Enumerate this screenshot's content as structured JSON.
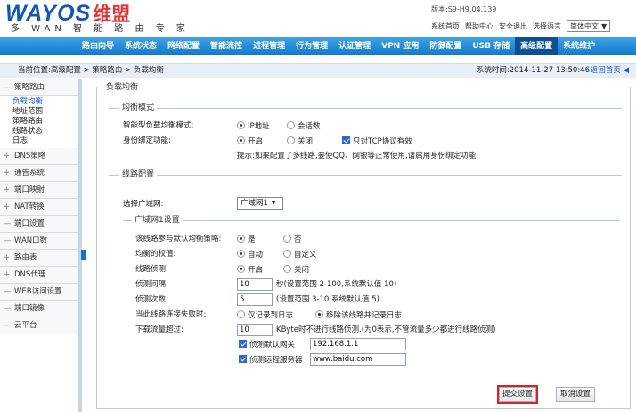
{
  "header": {
    "logo_text": "WAYOS",
    "logo_cn": "维盟",
    "logo_sub": "多 WAN 智 能 路 由 专 家",
    "version": "版本:S9-H9.04.139",
    "links": [
      "系统首页",
      "帮助中心",
      "安全退出",
      "选择语言"
    ],
    "language": "简体中文"
  },
  "nav": {
    "items": [
      "路由向导",
      "系统状态",
      "网络配置",
      "智能流控",
      "进程管理",
      "行为管理",
      "认证管理",
      "VPN 应用",
      "防御配置",
      "USB 存储",
      "高级配置",
      "系统维护"
    ],
    "active_index": 10
  },
  "breadcrumb": {
    "text": "当前位置:高级配置 > 策略路由 > 负载均衡",
    "time": "系统时间:2014-11-27 13:50:46",
    "home": "返回首页"
  },
  "sidebar": {
    "groups": [
      {
        "label": "策略路由",
        "sign": "—",
        "items": [
          "负载均衡",
          "地址范围",
          "策略路由",
          "线路状态",
          "日志"
        ]
      },
      {
        "label": "DNS策略",
        "sign": "+"
      },
      {
        "label": "通告系统",
        "sign": "+"
      },
      {
        "label": "端口映射",
        "sign": "+"
      },
      {
        "label": "NAT转换",
        "sign": "+"
      },
      {
        "label": "端口设置",
        "sign": "—"
      },
      {
        "label": "WAN口数",
        "sign": "—"
      },
      {
        "label": "路由表",
        "sign": "+"
      },
      {
        "label": "DNS代理",
        "sign": "+"
      },
      {
        "label": "WEB访问设置",
        "sign": "—"
      },
      {
        "label": "端口镜像",
        "sign": "—"
      },
      {
        "label": "云平台",
        "sign": "—"
      }
    ]
  },
  "form": {
    "panel_title": "负载均衡",
    "balance": {
      "title": "均衡模式",
      "mode_label": "智能型负载均衡模式:",
      "mode_options": [
        "IP地址",
        "会话数"
      ],
      "bind_label": "身份绑定功能:",
      "bind_options": [
        "开启",
        "关闭"
      ],
      "tcp_only": "只对TCP协议有效",
      "hint": "提示:如果配置了多线路,要使QQ、网银等正常使用,请启用身份绑定功能"
    },
    "line": {
      "title": "线路配置",
      "wan_label": "选择广域网:",
      "wan_value": "广域网1",
      "sub_title": "广域网1设置",
      "default_label": "该线路参与默认均衡策略:",
      "default_options": [
        "是",
        "否"
      ],
      "weight_label": "均衡的权值:",
      "weight_options": [
        "自动",
        "自定义"
      ],
      "detect_label": "线路侦测:",
      "detect_options": [
        "开启",
        "关闭"
      ],
      "interval_label": "侦测间隔:",
      "interval_value": "10",
      "interval_note": "秒(设置范围 2-100,系统默认值 10)",
      "count_label": "侦测次数:",
      "count_value": "5",
      "count_note": "(设置范围 3-10,系统默认值 5)",
      "lost_label": "当此线路连接失败时:",
      "lost_options": [
        "仅记录到日志",
        "移除该线路并记录日志"
      ],
      "flow_label": "下载流量超过:",
      "flow_value": "10",
      "flow_note": "KByte时不进行线路侦测.(为0表示,不管流量多少都进行线路侦测)",
      "gw_label": "侦测默认网关",
      "gw_value": "192.168.1.1",
      "remote_label": "侦测远程服务器",
      "remote_value": "www.baidu.com"
    },
    "submit": "提交设置",
    "cancel": "取消设置"
  }
}
